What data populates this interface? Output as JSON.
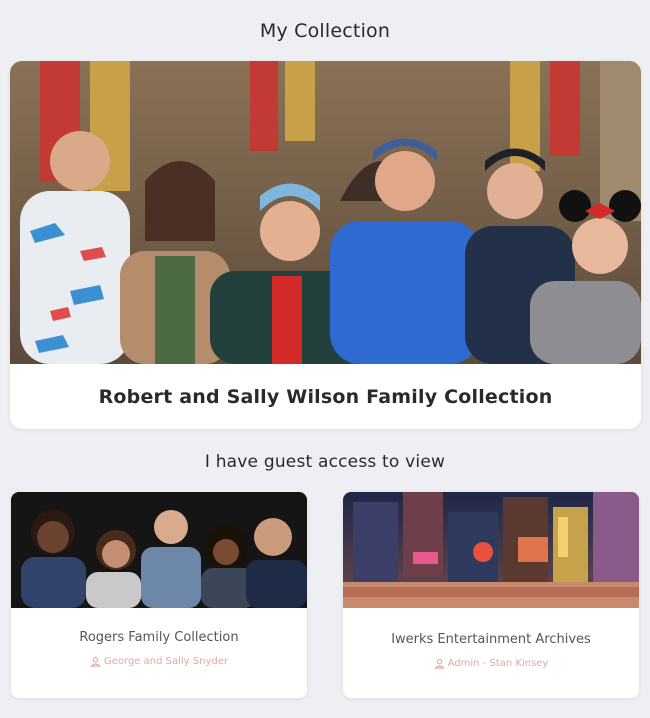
{
  "my_collection": {
    "heading": "My Collection",
    "card": {
      "title": "Robert and Sally Wilson Family Collection",
      "image_icon": "family-photo-castle"
    }
  },
  "guest_access": {
    "heading": "I have guest access to view",
    "cards": [
      {
        "title": "Rogers Family Collection",
        "owner": "George and Sally Snyder",
        "owner_icon": "user-icon",
        "image_icon": "family-portrait-photo"
      },
      {
        "title": "Iwerks Entertainment Archives",
        "owner": "Admin - Stan Kinsey",
        "owner_icon": "user-icon",
        "image_icon": "city-street-illustration"
      }
    ]
  },
  "colors": {
    "background": "#eeeff3",
    "card": "#ffffff",
    "owner_text": "#e3a9a0",
    "title_text": "#2a2a2a"
  }
}
